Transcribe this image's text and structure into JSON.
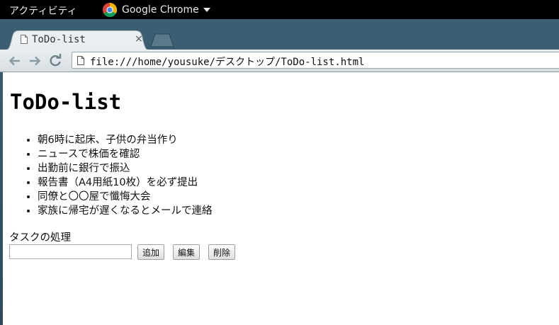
{
  "desktop": {
    "activities_label": "アクティビティ",
    "app_name": "Google Chrome"
  },
  "browser": {
    "tab_title": "ToDo-list",
    "tab_close": "×",
    "url": "file:///home/yousuke/デスクトップ/ToDo-list.html",
    "icons": {
      "back": "back-arrow-icon",
      "forward": "forward-arrow-icon",
      "reload": "reload-icon",
      "page": "page-icon",
      "close": "close-icon"
    },
    "colors": {
      "frame": "#2c4a5c",
      "toolbar": "#dfe5e8"
    }
  },
  "page": {
    "title": "ToDo-list",
    "items": [
      "朝6時に起床、子供の弁当作り",
      "ニュースで株価を確認",
      "出勤前に銀行で振込",
      "報告書（A4用紙10枚）を必ず提出",
      "同僚と〇〇屋で懺悔大会",
      "家族に帰宅が遅くなるとメールで連絡"
    ],
    "form": {
      "label": "タスクの処理",
      "input_value": "",
      "add_label": "追加",
      "edit_label": "編集",
      "delete_label": "削除"
    }
  }
}
